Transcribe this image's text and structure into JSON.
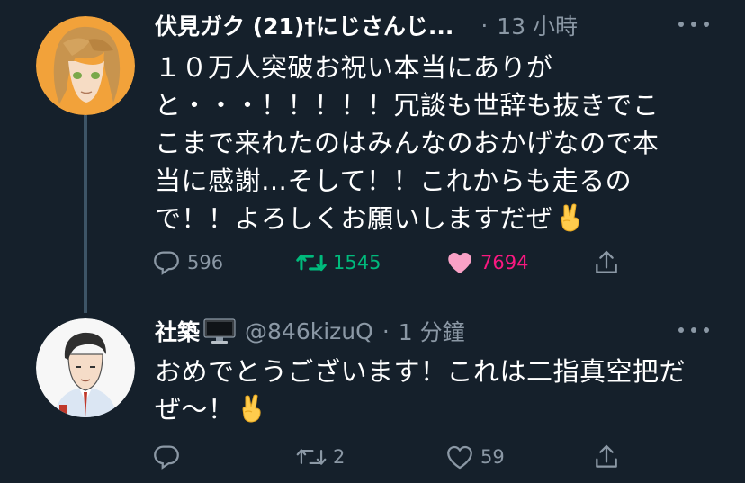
{
  "tweet1": {
    "display_name": "伏見ガク (21)†にじさんじ...",
    "separator": "·",
    "time": "13 小時",
    "text": "１０万人突破お祝い本当にありがと・・・！！！！！冗談も世辞も抜きでここまで来れたのはみんなのおかげなので本当に感謝…そして！！これからも走るので！！よろしくお願いしますだぜ",
    "emoji": "victory-hand",
    "replies": "596",
    "retweets": "1545",
    "likes": "7694"
  },
  "tweet2": {
    "display_name": "社築",
    "name_emoji": "desktop-computer",
    "handle": "@846kizuQ",
    "separator": "·",
    "time": "1 分鐘",
    "text": "おめでとうございます！これは二指真空把だぜ～！",
    "emoji": "victory-hand",
    "replies": "",
    "retweets": "2",
    "likes": "59"
  },
  "colors": {
    "background": "#15202b",
    "secondary_text": "#8b98a5",
    "retweet_active": "#00ba7c",
    "like_active": "#f91880",
    "thread_line": "#3d5466"
  },
  "icons": [
    "reply-icon",
    "retweet-icon",
    "like-icon",
    "share-icon",
    "more-icon"
  ]
}
